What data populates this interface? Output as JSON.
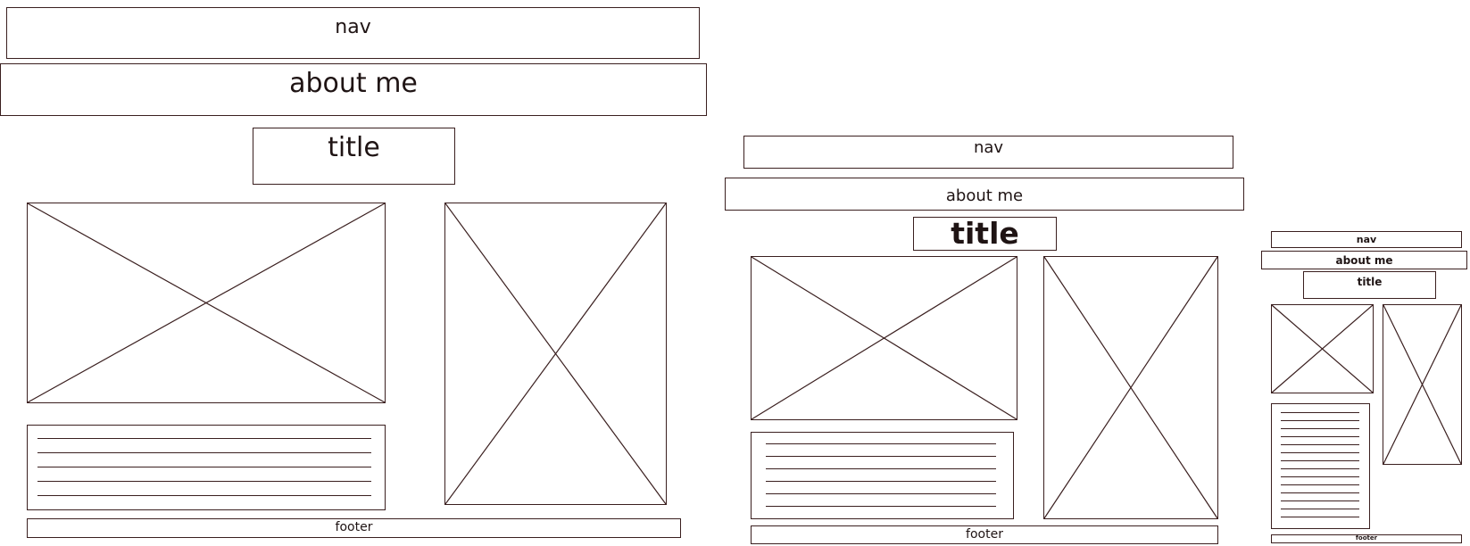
{
  "wireframes": {
    "large": {
      "nav_label": "nav",
      "about_label": "about me",
      "title_label": "title",
      "footer_label": "footer"
    },
    "medium": {
      "nav_label": "nav",
      "about_label": "about me",
      "title_label": "title",
      "footer_label": "footer"
    },
    "small": {
      "nav_label": "nav",
      "about_label": "about me",
      "title_label": "title",
      "footer_label": "footer"
    }
  },
  "colors": {
    "stroke": "#3a1f1f",
    "text": "#1f1414",
    "background": "#ffffff"
  }
}
